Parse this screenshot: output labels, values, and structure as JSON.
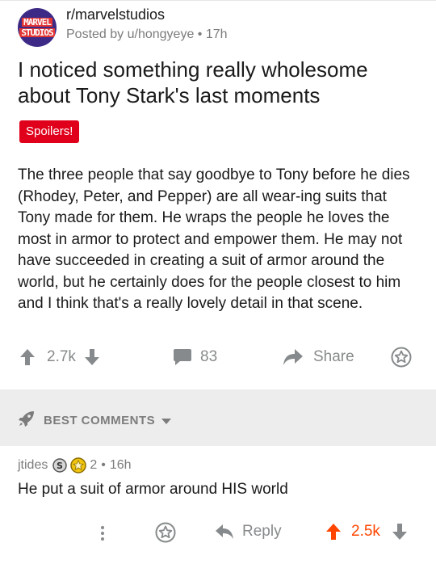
{
  "post": {
    "subreddit": "r/marvelstudios",
    "subreddit_logo_line1": "MARVEL",
    "subreddit_logo_line2": "STUDIOS",
    "meta": "Posted by u/hongyeye • 17h",
    "title": "I noticed something really wholesome about Tony Stark's last moments",
    "flair": "Spoilers!",
    "body": "The three people that say goodbye to Tony before he dies (Rhodey, Peter, and Pepper) are all wear-ing suits that Tony made for them. He wraps the people he loves the most in armor to protect and empower them. He may not have succeeded in creating a suit of armor around the world, but he certainly does for the people closest to him and I think that's a really lovely detail in that scene.",
    "upvotes": "2.7k",
    "comments": "83",
    "share_label": "Share"
  },
  "sort": {
    "label": "BEST COMMENTS"
  },
  "comment": {
    "author": "jtides",
    "award_count": "2",
    "age": "16h",
    "body": "He put a suit of armor around HIS world",
    "reply_label": "Reply",
    "score": "2.5k"
  },
  "colors": {
    "accent": "#ff4500",
    "flair_bg": "#e0001b",
    "muted": "#878a8c",
    "band": "#ededed"
  },
  "icons": {
    "upvote": "arrow-up-icon",
    "downvote": "arrow-down-icon",
    "comment": "chat-bubble-icon",
    "share": "share-arrow-icon",
    "award": "award-star-icon",
    "sort": "rocket-icon",
    "more": "more-vertical-icon"
  }
}
